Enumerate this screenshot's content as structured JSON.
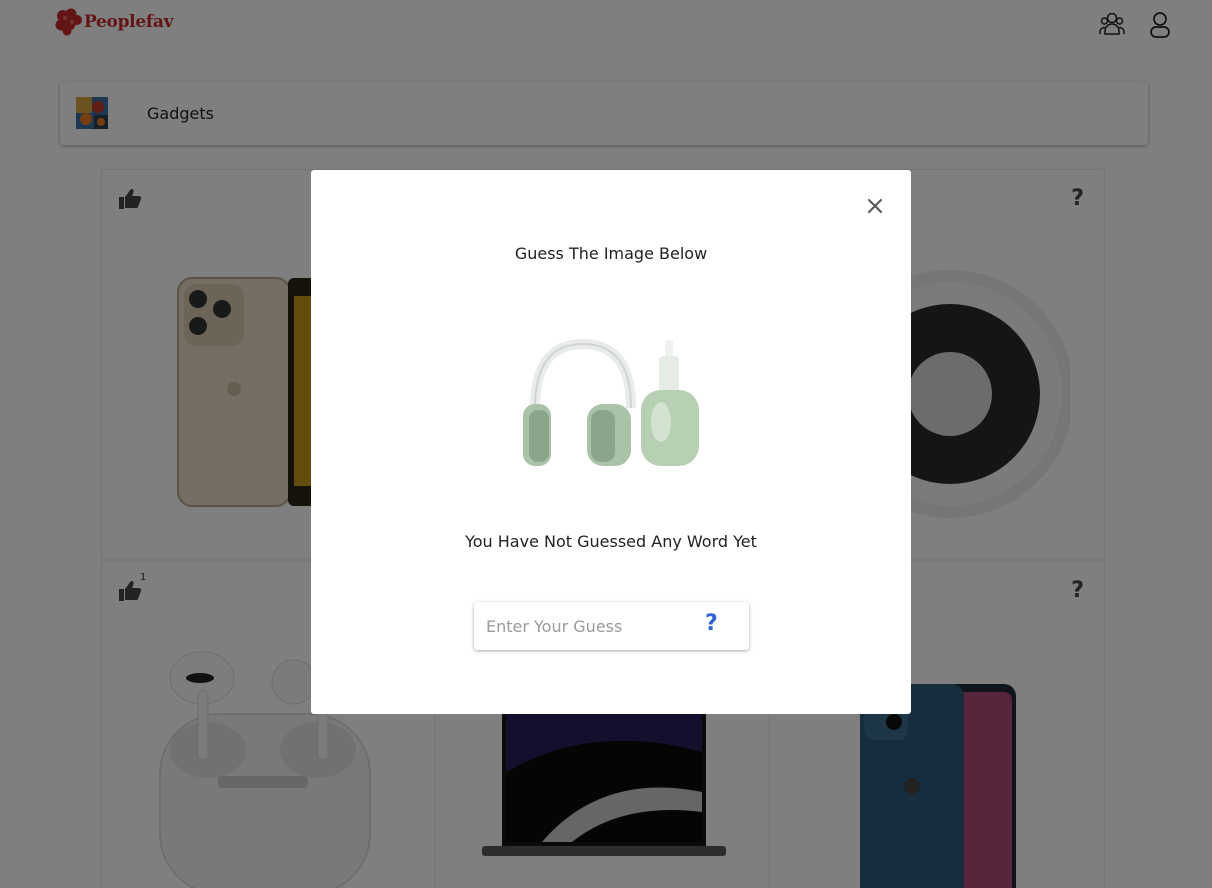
{
  "header": {
    "brand": "Peoplefav",
    "brand_color": "#c62b2b",
    "icons": [
      "group-icon",
      "user-icon"
    ]
  },
  "category": {
    "label": "Gadgets",
    "icon": "category-image-icon"
  },
  "cards": [
    {
      "name": "iphone-13-pro-gold",
      "like_count": "",
      "hint": "?"
    },
    {
      "name": "card-hidden-behind-modal",
      "like_count": "",
      "hint": "?"
    },
    {
      "name": "airtag",
      "like_count": "",
      "hint": "?"
    },
    {
      "name": "airpods-pro",
      "like_count": "1",
      "hint": "?"
    },
    {
      "name": "macbook-pro",
      "like_count": "",
      "hint": "?"
    },
    {
      "name": "iphone-13-blue",
      "like_count": "",
      "hint": "?"
    }
  ],
  "modal": {
    "title": "Guess The Image Below",
    "image": "airpods-max-green",
    "status": "You Have Not Guessed Any Word Yet",
    "input_placeholder": "Enter Your Guess",
    "input_value": "",
    "hint_label": "?",
    "close_icon": "close-icon",
    "accent": "#2f63d6"
  }
}
